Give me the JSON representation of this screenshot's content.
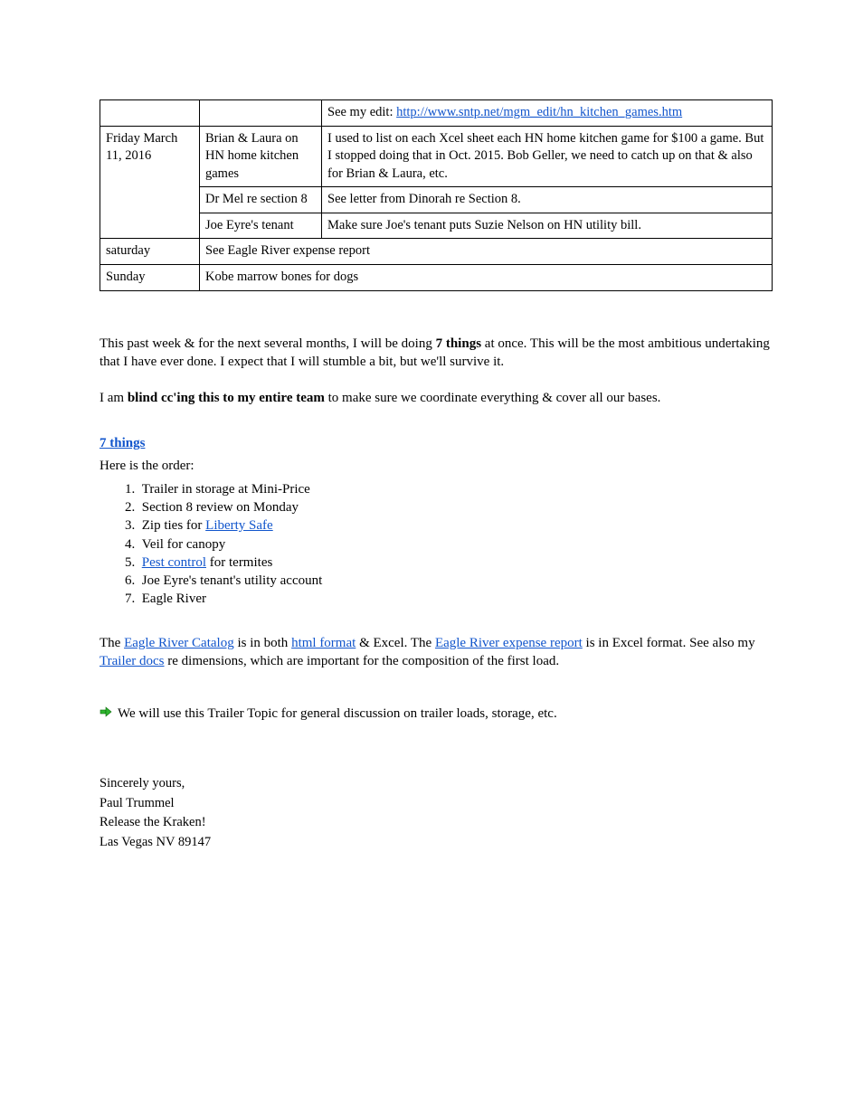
{
  "table": {
    "r1": {
      "c1": "",
      "c2": "",
      "c3_pre": "See my edit: ",
      "c3_link": "http://www.sntp.net/mgm_edit/hn_kitchen_games.htm",
      "c3_post": ""
    },
    "r2": {
      "c1": "Friday March 11, 2016",
      "c2": "Brian & Laura on HN home kitchen games",
      "c3": "I used to list on each Xcel sheet each HN home kitchen game for $100 a game. But I stopped doing that in Oct. 2015. Bob Geller, we need to catch up on that & also for Brian & Laura, etc."
    },
    "r3": {
      "c2": "Dr Mel re section 8",
      "c3": "See letter from Dinorah re Section 8."
    },
    "r4": {
      "c2": "Joe Eyre's tenant",
      "c3": "Make sure Joe's tenant puts Suzie Nelson on HN utility bill."
    },
    "r5": {
      "c1": "saturday",
      "c2": "See Eagle River expense report"
    },
    "r6": {
      "c1": "Sunday",
      "c2": "Kobe marrow bones for dogs"
    }
  },
  "body": {
    "p1": {
      "pre": "This past week & for the next several months, I will be doing ",
      "bold": "7 things",
      "post": " at once.  This will be the most ambitious undertaking that I have ever done.  I expect that I will stumble a bit, but we'll survive it."
    },
    "p2": {
      "pre": "I am ",
      "bold": "blind cc'ing this to my entire team",
      "post": " to make sure we coordinate everything & cover all our bases."
    },
    "link7": "7 things",
    "p3": "Here is the order:",
    "list": {
      "i1": "Trailer in storage at Mini-Price",
      "i2": "Section 8 review on Monday",
      "i3_pre": "Zip ties for ",
      "i3_link": "Liberty Safe",
      "i4": "Veil for canopy",
      "i5_link": "Pest control",
      "i5_post": " for termites",
      "i6": "Joe Eyre's tenant's utility account",
      "i7": "Eagle River"
    },
    "p4_pre": "The ",
    "p4_link1": "Eagle River Catalog",
    "p4_mid": " is in both ",
    "p4_link2": "html format",
    "p4_mid2": " & Excel.  The ",
    "p4_link3": "Eagle River expense report",
    "p4_post": " is in Excel format.  See also my ",
    "p4_link4": "Trailer docs",
    "p4_post2": " re dimensions, which are important for the composition of the first load."
  },
  "arrow_text": "We will use this Trailer Topic for general discussion on trailer loads, storage, etc.",
  "sig": {
    "l1": "Sincerely yours,",
    "l2": "Paul Trummel",
    "l3": "Release the Kraken!",
    "l4": "Las Vegas NV 89147"
  }
}
